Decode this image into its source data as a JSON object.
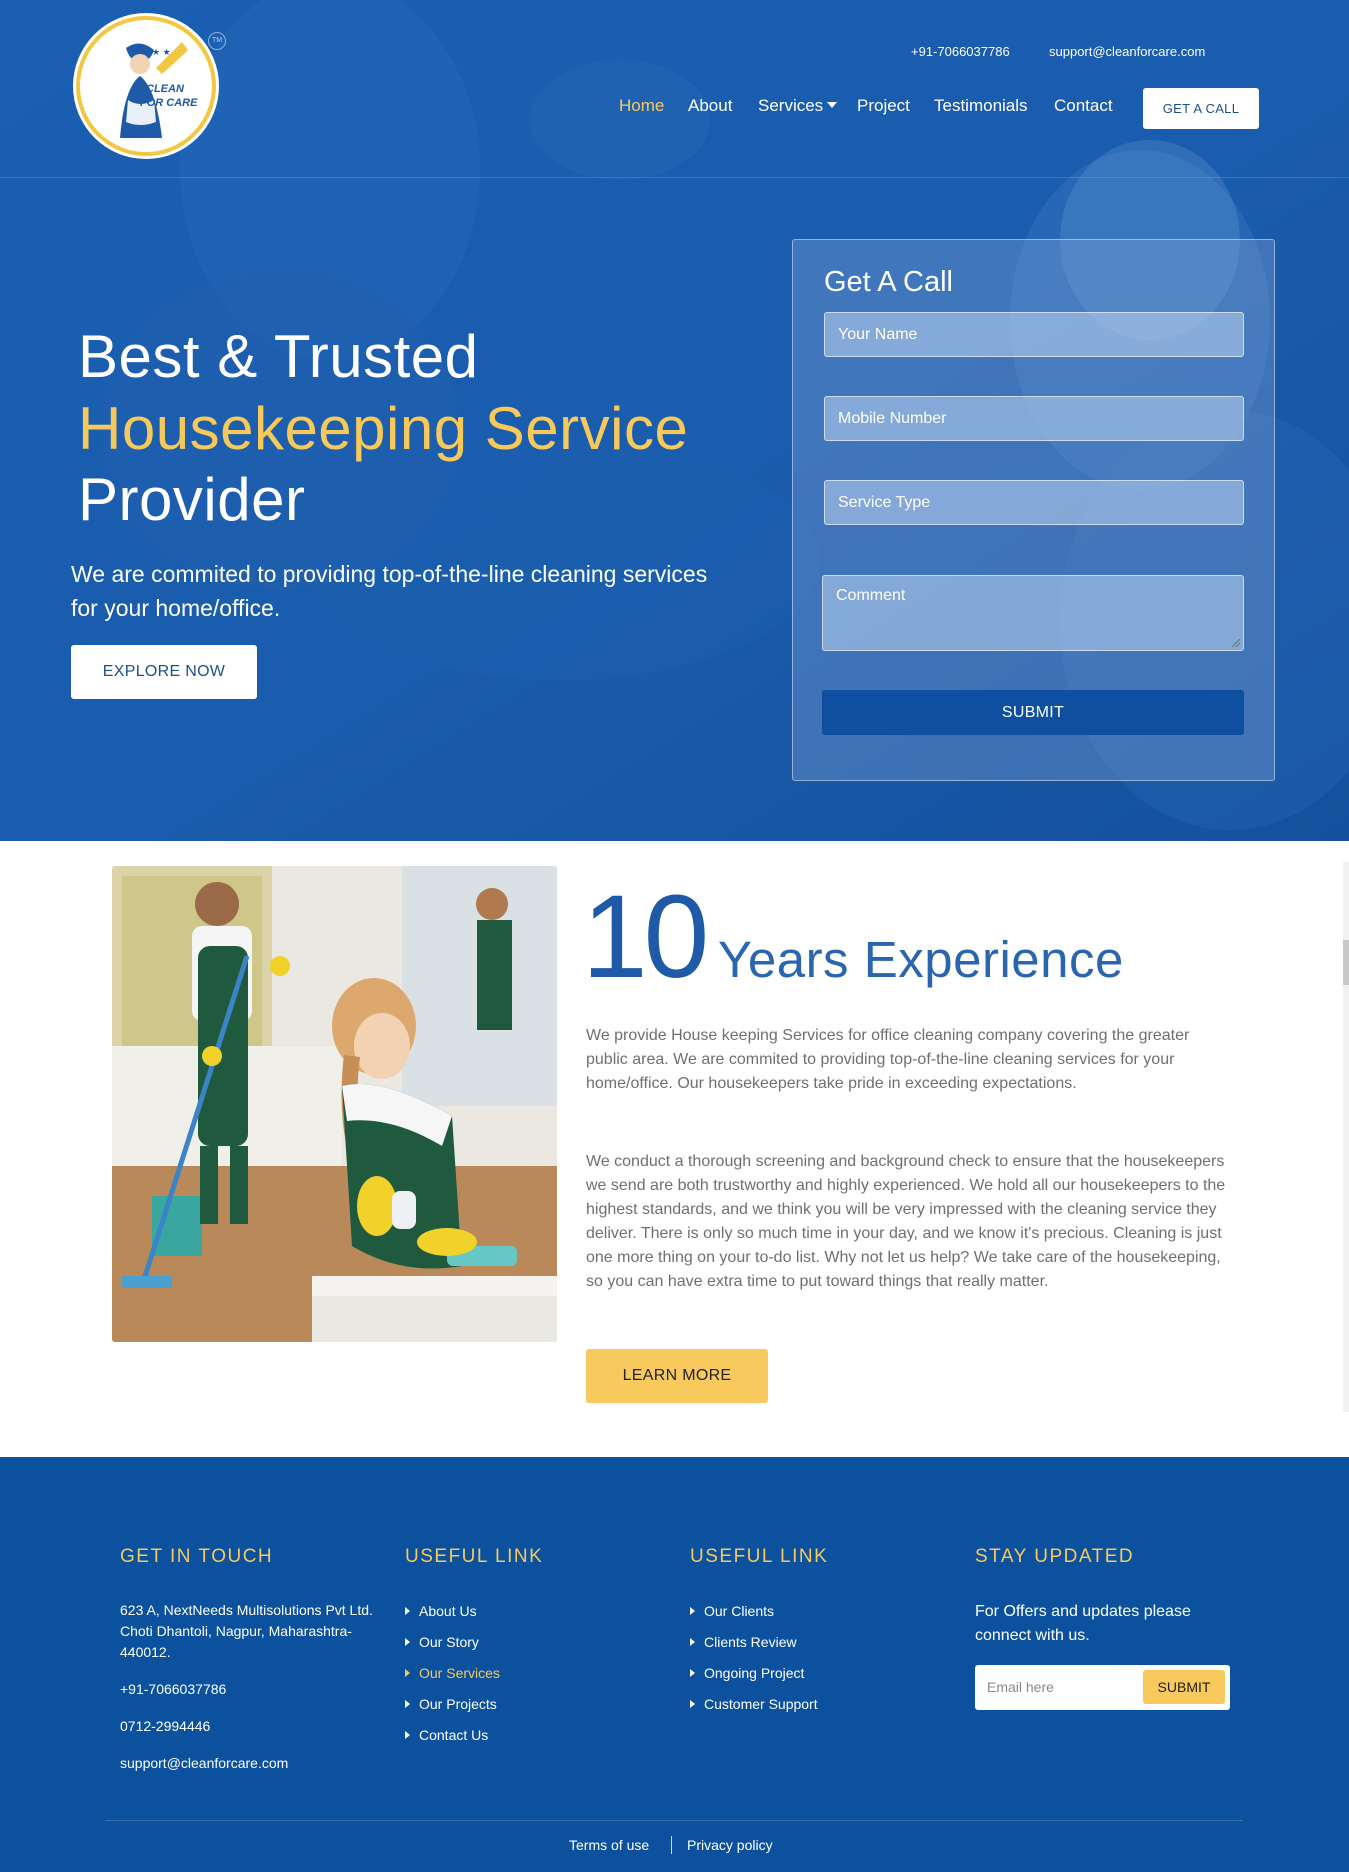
{
  "header": {
    "phone": "+91-7066037786",
    "email": "support@cleanforcare.com",
    "nav": {
      "home": "Home",
      "about": "About",
      "services": "Services",
      "project": "Project",
      "testimonials": "Testimonials",
      "contact": "Contact"
    },
    "cta": "GET A CALL",
    "logo_text": "CLEAN FOR CARE",
    "logo_mark": "TM"
  },
  "hero": {
    "title_line1": "Best & Trusted",
    "title_line2": "Housekeeping Service",
    "title_line3": "Provider",
    "subtitle": "We are commited to providing top-of-the-line cleaning services for your home/office.",
    "explore_label": "EXPLORE NOW"
  },
  "call_form": {
    "title": "Get A Call",
    "name_placeholder": "Your Name",
    "mobile_placeholder": "Mobile Number",
    "service_placeholder": "Service Type",
    "comment_placeholder": "Comment",
    "submit_label": "SUBMIT"
  },
  "about": {
    "number": "10",
    "years_label": "Years Experience",
    "para1": "We provide House keeping Services for office cleaning company covering the greater public area. We are commited to providing top-of-the-line cleaning services for your home/office. Our housekeepers take pride in exceeding expectations.",
    "para2": "We conduct a thorough screening and background check to ensure that the housekeepers we send are both trustworthy and highly experienced. We hold all our housekeepers to the highest standards, and we think you will be very impressed with the cleaning service they deliver. There is only so much time in your day, and we know it's precious. Cleaning is just one more thing on your to-do list. Why not let us help? We take care of the housekeeping, so you can have extra time to put toward things that really matter.",
    "learn_more_label": "LEARN MORE"
  },
  "footer": {
    "touch_heading": "GET IN TOUCH",
    "address": "623 A, NextNeeds Multisolutions Pvt Ltd. Choti Dhantoli, Nagpur, Maharashtra-440012.",
    "phone": "+91-7066037786",
    "landline": "0712-2994446",
    "email": "support@cleanforcare.com",
    "useful1_heading": "USEFUL LINK",
    "useful1": [
      "About Us",
      "Our Story",
      "Our Services",
      "Our Projects",
      "Contact Us"
    ],
    "useful2_heading": "USEFUL LINK",
    "useful2": [
      "Our Clients",
      "Clients Review",
      "Ongoing Project",
      "Customer Support"
    ],
    "updates_heading": "STAY UPDATED",
    "updates_text": "For Offers and updates please connect with us.",
    "email_placeholder": "Email here",
    "email_submit": "SUBMIT",
    "terms": "Terms of use",
    "privacy": "Privacy policy"
  },
  "colors": {
    "primary_blue": "#1558ab",
    "footer_blue": "#0c519e",
    "accent_yellow": "#f7c95b",
    "button_blue": "#0e4f9f"
  }
}
